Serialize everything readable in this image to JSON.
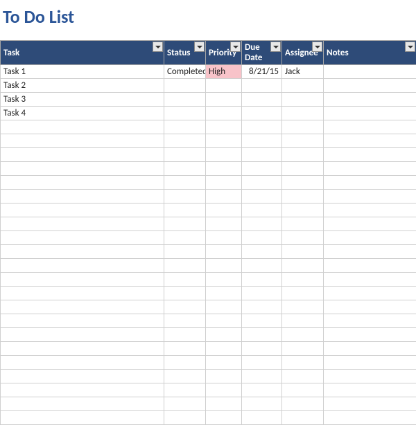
{
  "title": "To Do List",
  "columns": {
    "task": "Task",
    "status": "Status",
    "priority": "Priority",
    "due_date": "Due Date",
    "assignee": "Assignee",
    "notes": "Notes"
  },
  "rows": [
    {
      "task": "Task 1",
      "status": "Completed",
      "priority": "High",
      "priority_level": "high",
      "due_date": "8/21/15",
      "assignee": "Jack",
      "notes": ""
    },
    {
      "task": "Task 2",
      "status": "",
      "priority": "",
      "priority_level": "",
      "due_date": "",
      "assignee": "",
      "notes": ""
    },
    {
      "task": "Task 3",
      "status": "",
      "priority": "",
      "priority_level": "",
      "due_date": "",
      "assignee": "",
      "notes": ""
    },
    {
      "task": "Task 4",
      "status": "",
      "priority": "",
      "priority_level": "",
      "due_date": "",
      "assignee": "",
      "notes": ""
    }
  ],
  "empty_row_count": 22,
  "colors": {
    "header_bg": "#2e4b78",
    "title_color": "#2b5597",
    "priority_high_bg": "#f8c3c9"
  }
}
